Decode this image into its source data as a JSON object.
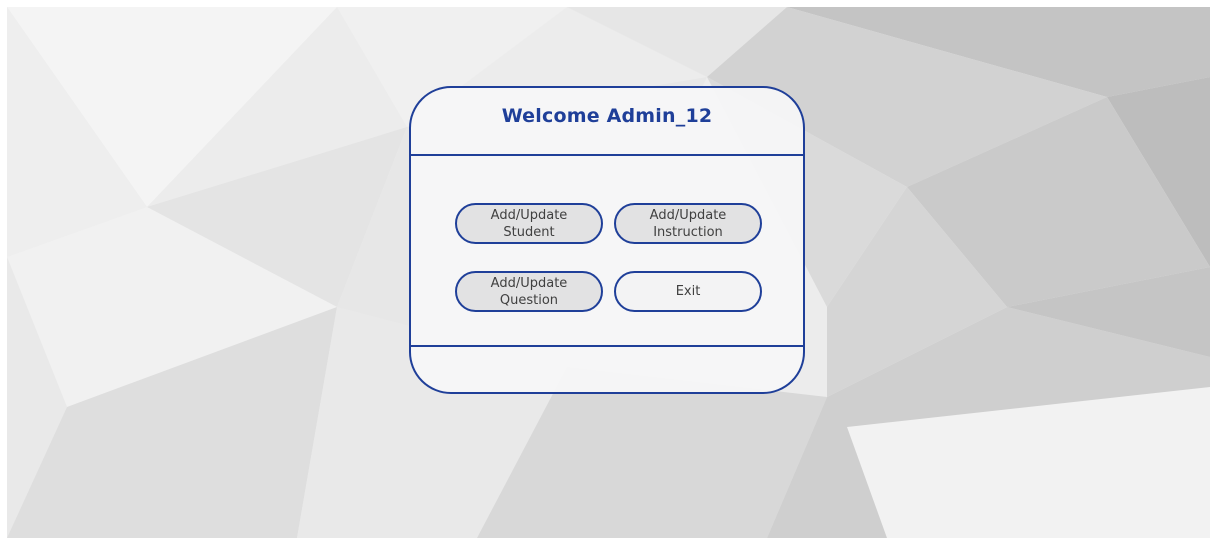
{
  "window": {
    "welcome_title": "Welcome Admin_12"
  },
  "menu": {
    "add_update_student": "Add/Update\nStudent",
    "add_update_instruction": "Add/Update\nInstruction",
    "add_update_question": "Add/Update\nQuestion",
    "exit": "Exit"
  },
  "colors": {
    "accent": "#1f3f99",
    "button_fill": "#e2e2e3",
    "panel_fill": "#f6f6f7",
    "text": "#404040"
  }
}
